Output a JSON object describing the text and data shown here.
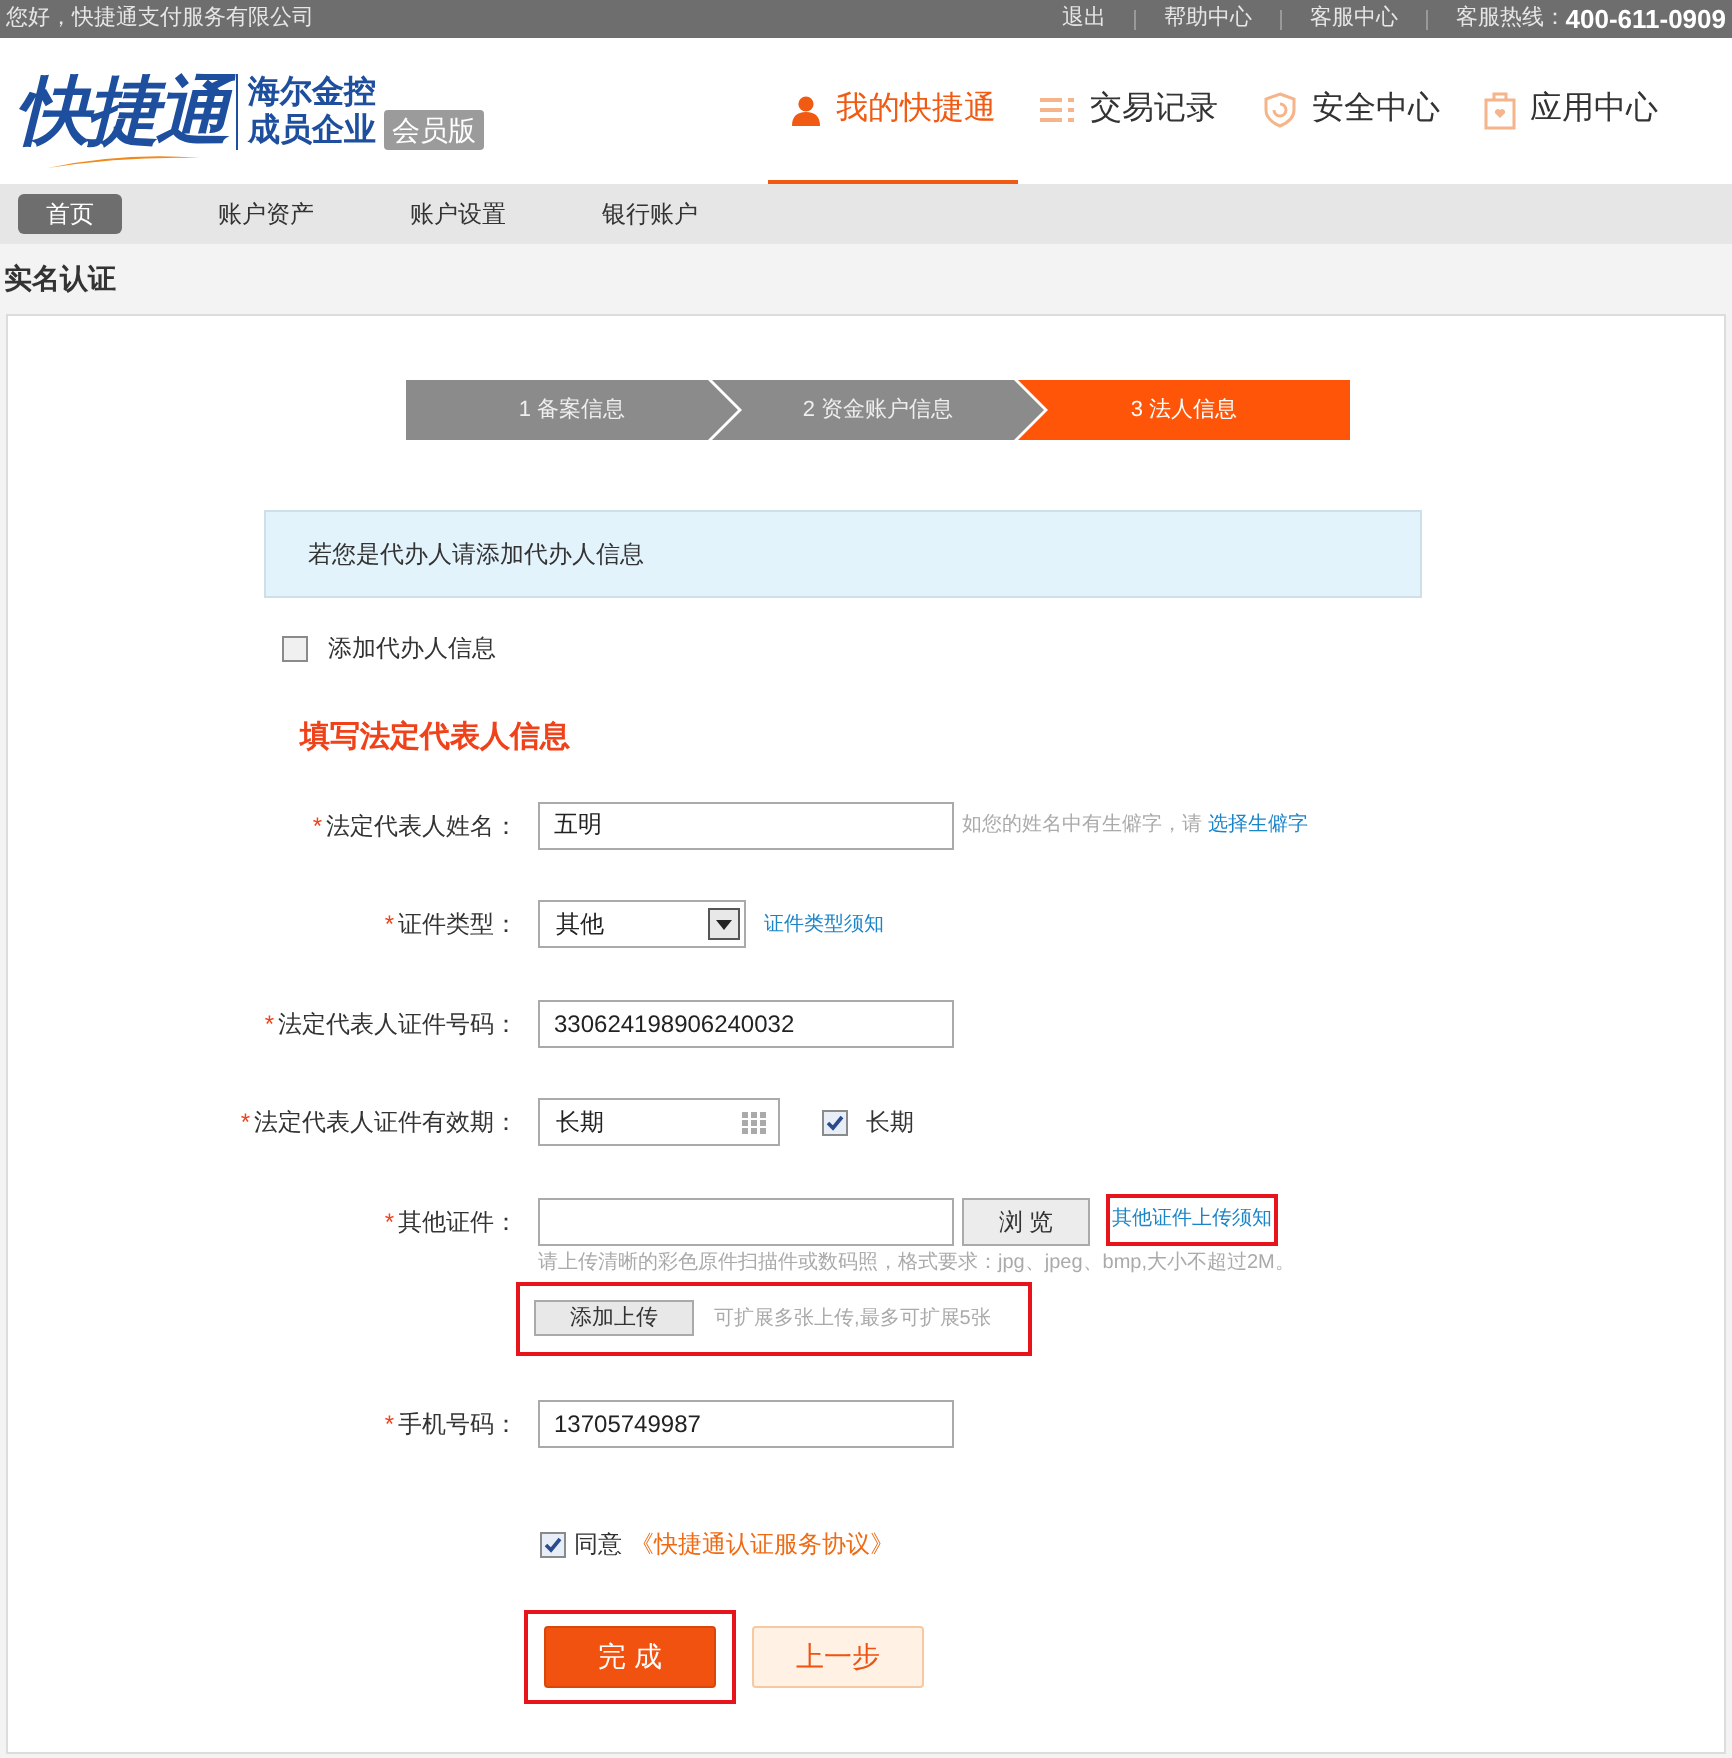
{
  "top_bar": {
    "greeting": "您好，快捷通支付服务有限公司",
    "links": [
      "退出",
      "帮助中心",
      "客服中心"
    ],
    "hotline_label": "客服热线：",
    "hotline": "400-611-0909"
  },
  "header": {
    "logo": "快捷通",
    "tagline": [
      "海尔金控",
      "成员企业"
    ],
    "edition_badge": "会员版",
    "nav": [
      {
        "label": "我的快捷通",
        "kind": "user",
        "selected": true
      },
      {
        "label": "交易记录",
        "kind": "list",
        "selected": false
      },
      {
        "label": "安全中心",
        "kind": "shield",
        "selected": false
      },
      {
        "label": "应用中心",
        "kind": "bag",
        "selected": false
      }
    ]
  },
  "subnav": [
    {
      "label": "首页",
      "selected": true
    },
    {
      "label": "账户资产",
      "selected": false
    },
    {
      "label": "账户设置",
      "selected": false
    },
    {
      "label": "银行账户",
      "selected": false
    }
  ],
  "page_title": "实名认证",
  "steps": [
    {
      "label": "1 备案信息",
      "selected": false
    },
    {
      "label": "2 资金账户信息",
      "selected": false
    },
    {
      "label": "3 法人信息",
      "selected": true
    }
  ],
  "notice": "若您是代办人请添加代办人信息",
  "agent_checkbox": {
    "label": "添加代办人信息",
    "checked": false
  },
  "section_title": "填写法定代表人信息",
  "fields": [
    {
      "kind": "text",
      "required_mark": "*",
      "label": "法定代表人姓名：",
      "value": "五明",
      "hint": "如您的姓名中有生僻字，请",
      "link": "选择生僻字"
    },
    {
      "kind": "select",
      "required_mark": "*",
      "label": "证件类型：",
      "value": "其他",
      "link": "证件类型须知"
    },
    {
      "kind": "text",
      "required_mark": "*",
      "label": "法定代表人证件号码：",
      "value": "330624198906240032"
    },
    {
      "kind": "date",
      "required_mark": "*",
      "label": "法定代表人证件有效期：",
      "value": "长期",
      "checkbox": {
        "label": "长期",
        "checked": true
      }
    },
    {
      "kind": "file",
      "required_mark": "*",
      "label": "其他证件：",
      "button": "浏 览",
      "link": "其他证件上传须知",
      "link_annotated": true,
      "hint": "请上传清晰的彩色原件扫描件或数码照，格式要求：jpg、jpeg、bmp,大小不超过2M。",
      "add_button": "添加上传",
      "add_hint": "可扩展多张上传,最多可扩展5张",
      "add_annotated": true
    },
    {
      "kind": "text",
      "required_mark": "*",
      "label": "手机号码：",
      "value": "13705749987"
    }
  ],
  "agreement": {
    "checked": true,
    "label": "同意",
    "link": "《快捷通认证服务协议》"
  },
  "buttons": [
    {
      "kind": "primary",
      "label": "完 成",
      "annotated": true
    },
    {
      "kind": "secondary",
      "label": "上一步",
      "annotated": false
    }
  ]
}
